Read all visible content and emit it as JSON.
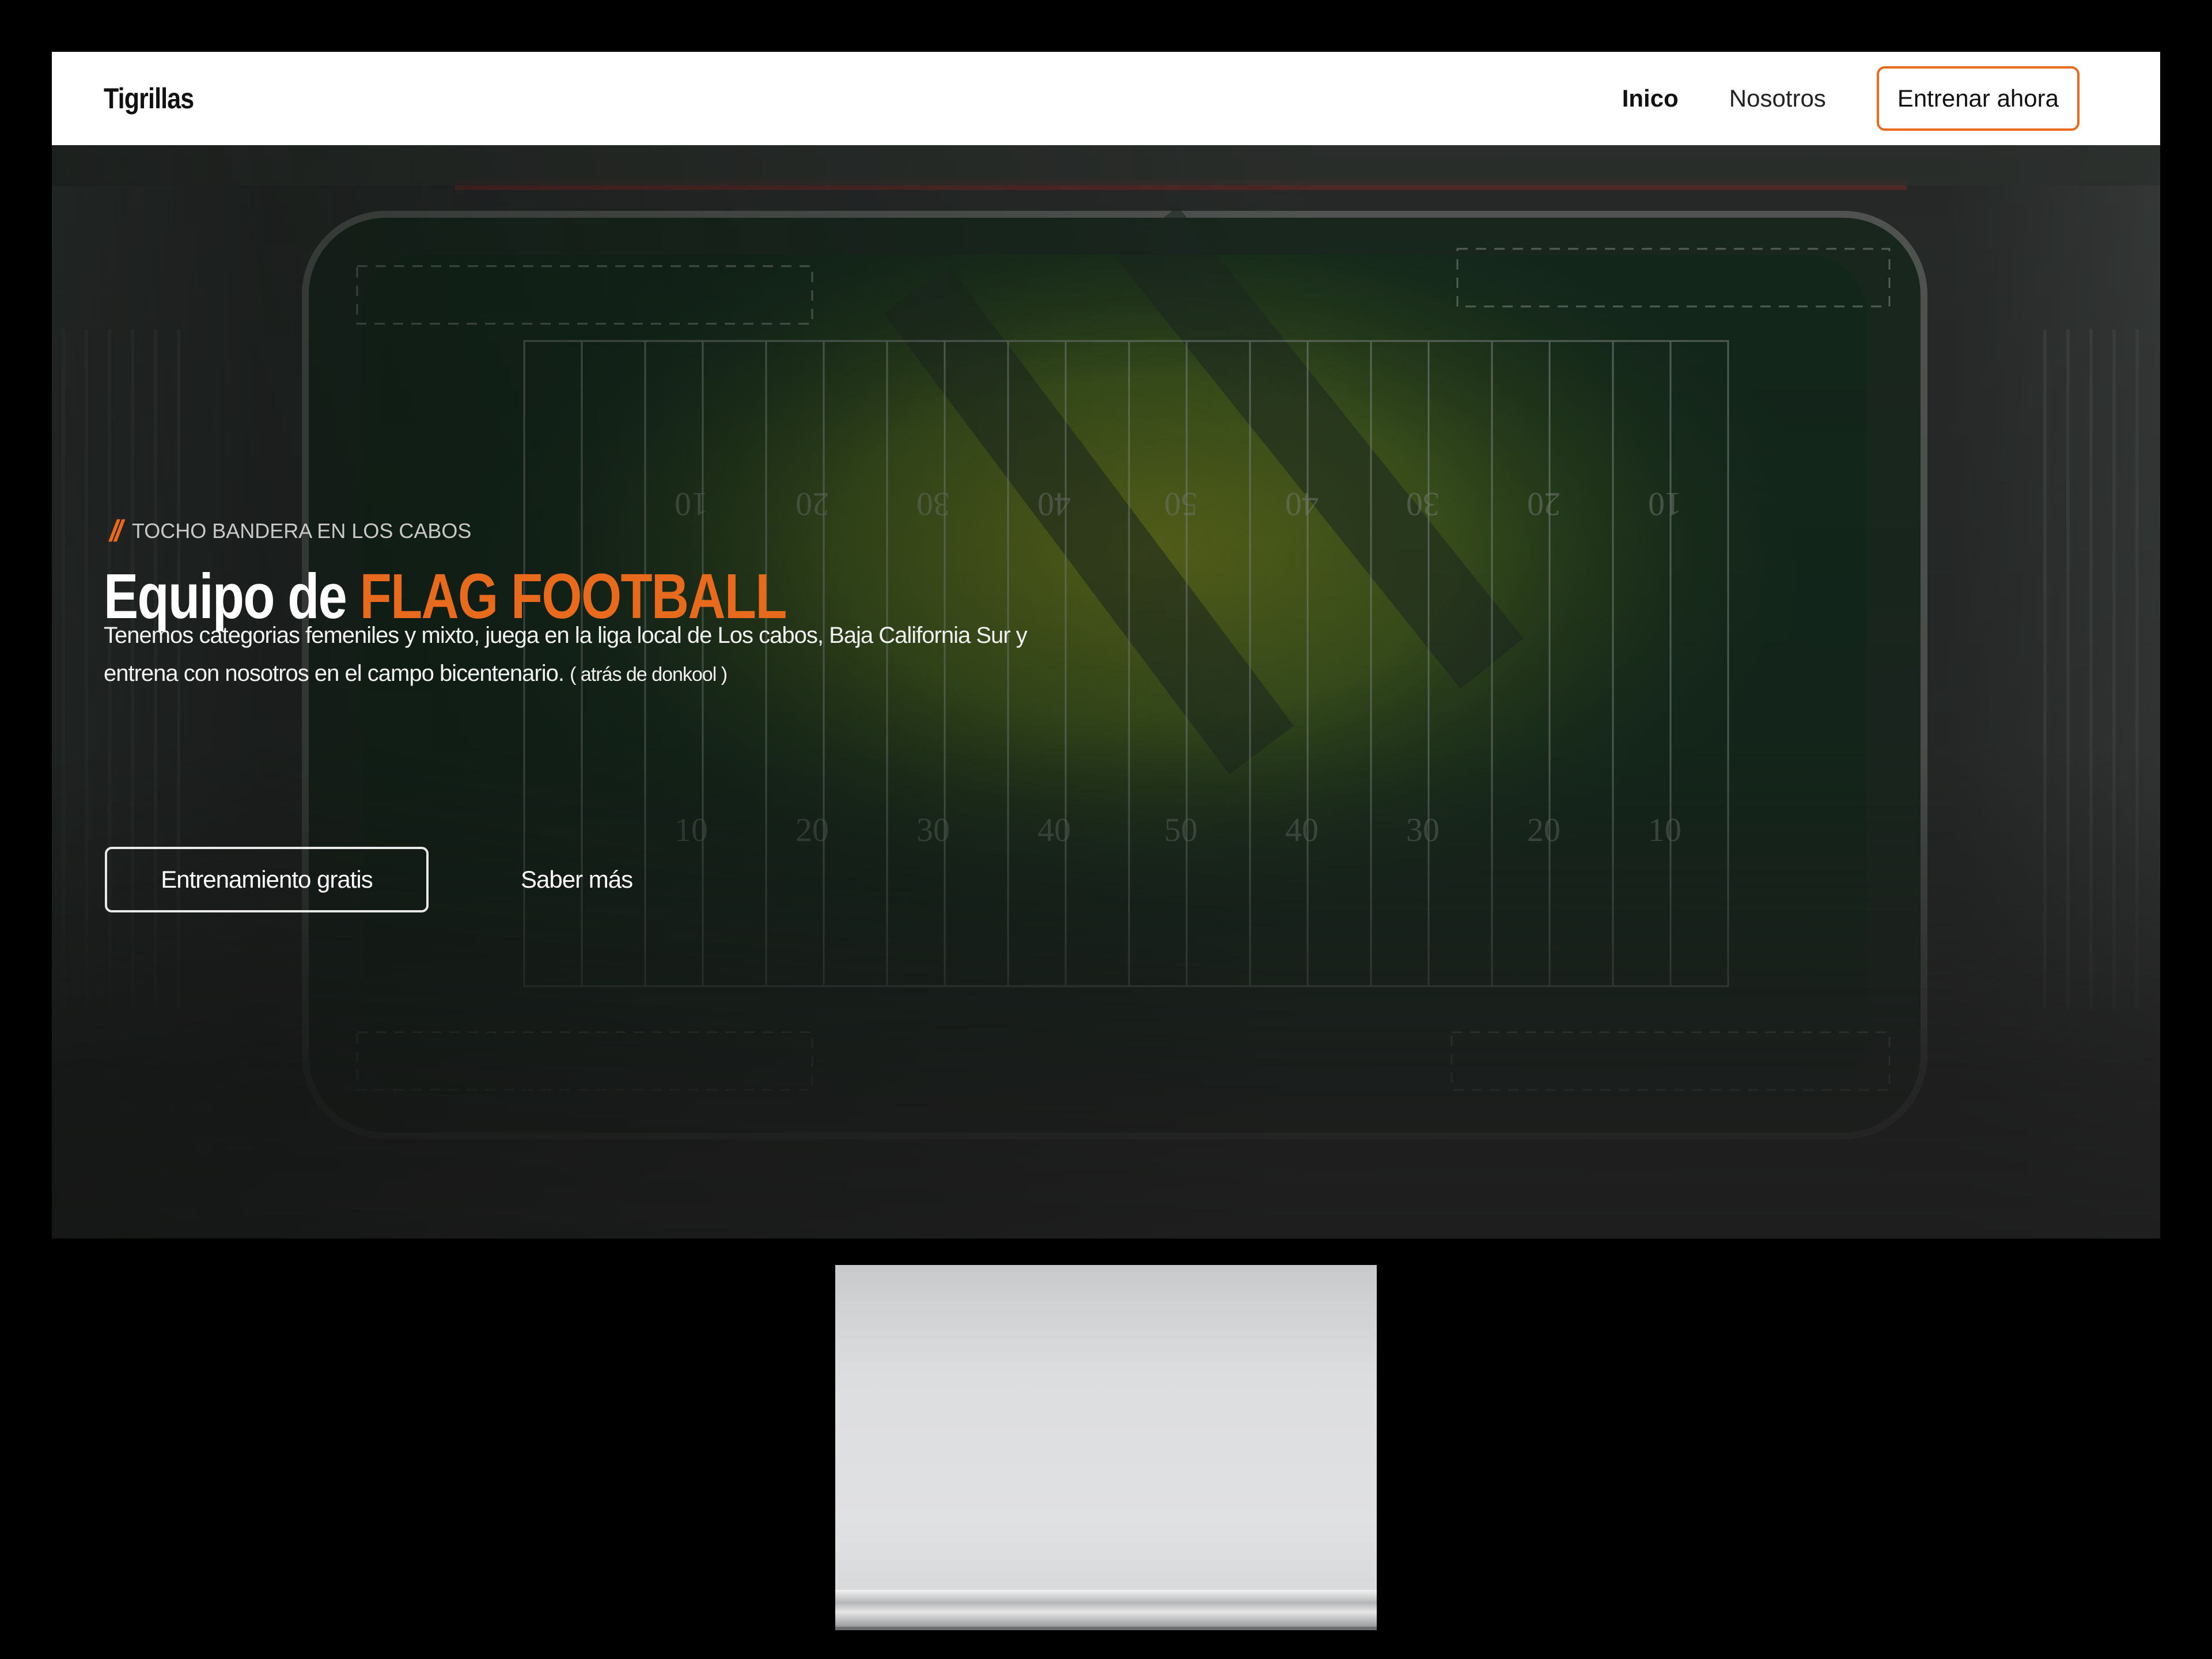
{
  "navbar": {
    "brand": "Tigrillas",
    "links": [
      {
        "label": "Inico",
        "active": true
      },
      {
        "label": "Nosotros",
        "active": false
      }
    ],
    "cta_label": "Entrenar ahora"
  },
  "hero": {
    "eyebrow_mark": "//",
    "eyebrow": "TOCHO BANDERA EN LOS CABOS",
    "headline_prefix": "Equipo de ",
    "headline_accent": "FLAG FOOTBALL",
    "lede": "Tenemos categorias femeniles y mixto, juega en la liga local de Los cabos, Baja California Sur y entrena con nosotros en el campo bicentenario. ",
    "lede_note": "( atrás de donkool )",
    "primary_button": "Entrenamiento gratis",
    "secondary_link": "Saber más",
    "field_numbers_bottom": [
      "10",
      "20",
      "30",
      "40",
      "50",
      "40",
      "30",
      "20",
      "10"
    ],
    "field_numbers_top": [
      "10",
      "20",
      "30",
      "40",
      "50",
      "40",
      "30",
      "20",
      "10"
    ]
  },
  "colors": {
    "accent": "#e86a1c",
    "navbar_bg": "#ffffff",
    "hero_text": "#ffffff"
  }
}
